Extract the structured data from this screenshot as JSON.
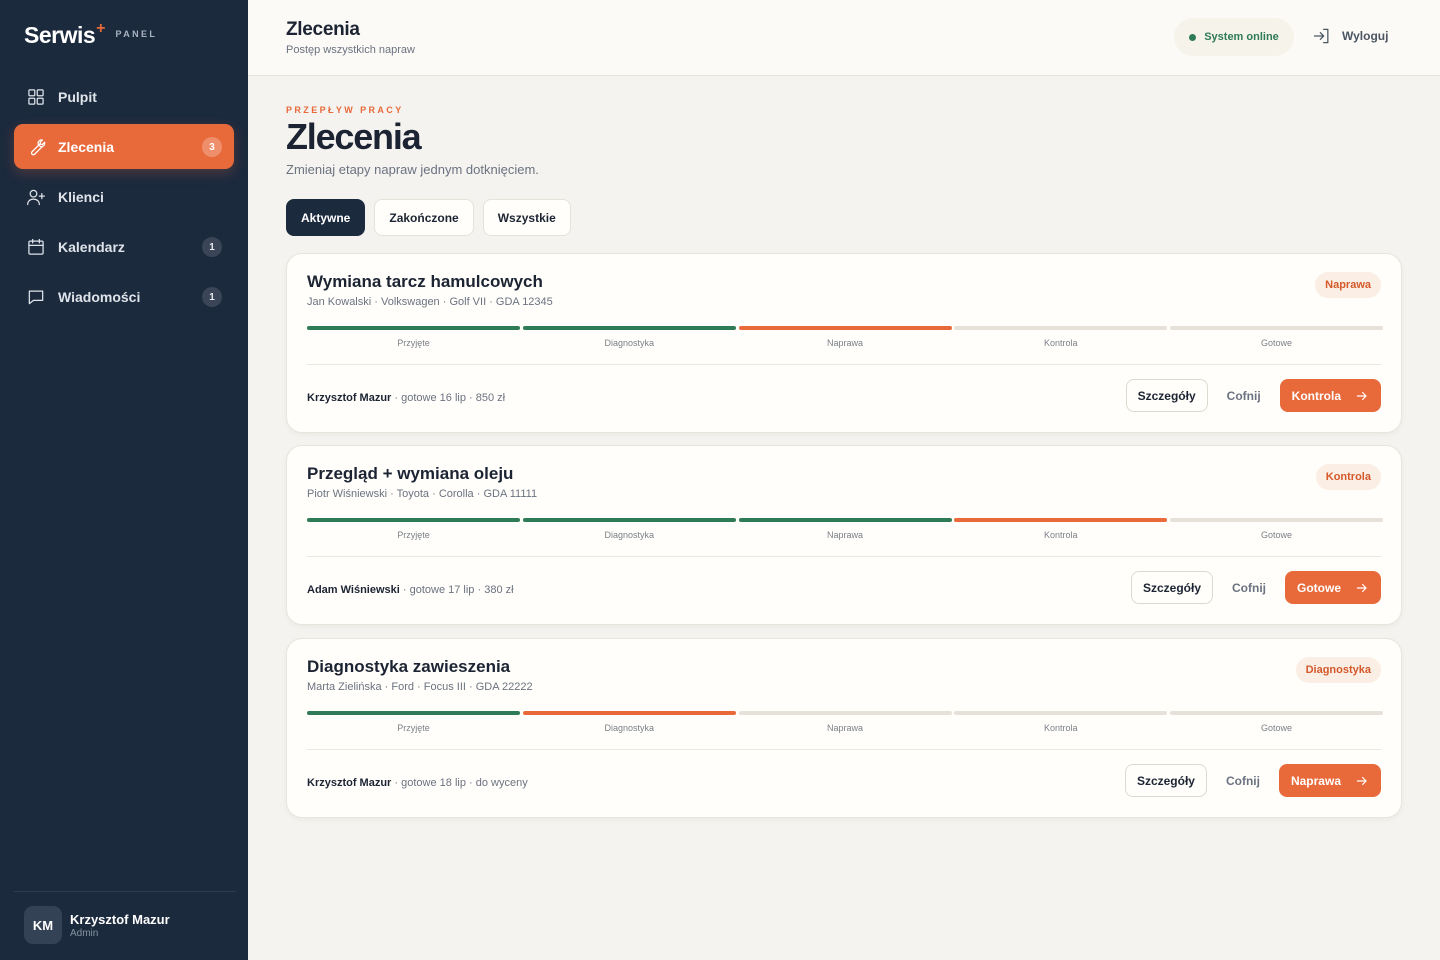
{
  "brand": {
    "name": "Serwis",
    "plus": "+",
    "sub": "PANEL"
  },
  "sidebar": {
    "items": [
      {
        "label": "Pulpit",
        "icon": "grid-icon",
        "badge": ""
      },
      {
        "label": "Zlecenia",
        "icon": "wrench-icon",
        "badge": "3",
        "active": true
      },
      {
        "label": "Klienci",
        "icon": "user-plus-icon",
        "badge": ""
      },
      {
        "label": "Kalendarz",
        "icon": "calendar-icon",
        "badge": "1"
      },
      {
        "label": "Wiadomości",
        "icon": "message-icon",
        "badge": "1"
      }
    ],
    "user": {
      "initials": "KM",
      "name": "Krzysztof Mazur",
      "role": "Admin"
    }
  },
  "header": {
    "title": "Zlecenia",
    "subtitle": "Postęp wszystkich napraw",
    "status": "System online",
    "logout": "Wyloguj"
  },
  "main": {
    "eyebrow": "PRZEPŁYW PRACY",
    "title": "Zlecenia",
    "subtitle": "Zmieniaj etapy napraw jednym dotknięciem.",
    "tabs": [
      {
        "label": "Aktywne",
        "active": true
      },
      {
        "label": "Zakończone",
        "active": false
      },
      {
        "label": "Wszystkie",
        "active": false
      }
    ]
  },
  "colors": {
    "accent": "#e8693a",
    "done": "#2f7a57",
    "sidebar": "#1c2a3e",
    "pending": "#e6e1d9"
  },
  "stages": [
    "Przyjęte",
    "Diagnostyka",
    "Naprawa",
    "Kontrola",
    "Gotowe"
  ],
  "actions": {
    "details": "Szczegóły",
    "back": "Cofnij"
  },
  "orders": [
    {
      "title": "Wymiana tarcz hamulcowych",
      "meta": "Jan Kowalski · Volkswagen · Golf VII · GDA 12345",
      "stage_badge": "Naprawa",
      "stage_index": 2,
      "mechanic": "Krzysztof Mazur",
      "footer": " · gotowe 16 lip · 850 zł",
      "next": "Kontrola"
    },
    {
      "title": "Przegląd + wymiana oleju",
      "meta": "Piotr Wiśniewski · Toyota · Corolla · GDA 11111",
      "stage_badge": "Kontrola",
      "stage_index": 3,
      "mechanic": "Adam Wiśniewski",
      "footer": " · gotowe 17 lip · 380 zł",
      "next": "Gotowe"
    },
    {
      "title": "Diagnostyka zawieszenia",
      "meta": "Marta Zielińska · Ford · Focus III · GDA 22222",
      "stage_badge": "Diagnostyka",
      "stage_index": 1,
      "mechanic": "Krzysztof Mazur",
      "footer": " · gotowe 18 lip · do wyceny",
      "next": "Naprawa"
    }
  ]
}
